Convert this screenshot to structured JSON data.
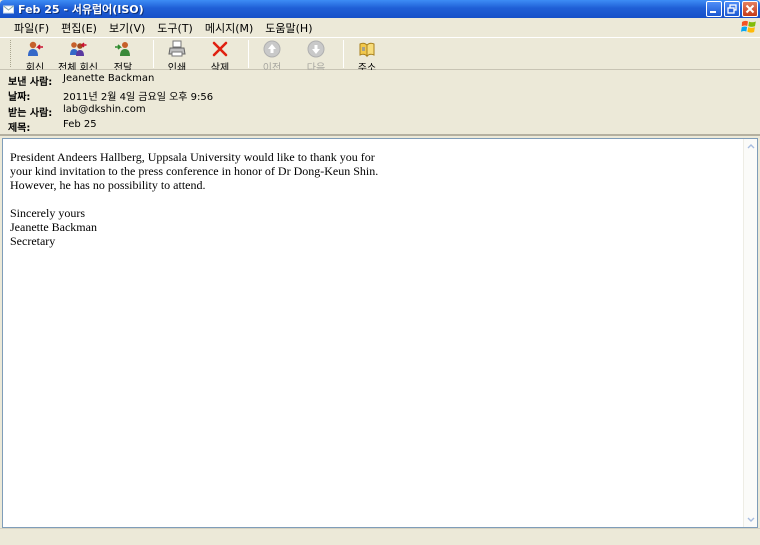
{
  "window": {
    "title": "Feb 25 - 서유럽어(ISO)"
  },
  "menu": [
    "파일(F)",
    "편집(E)",
    "보기(V)",
    "도구(T)",
    "메시지(M)",
    "도움말(H)"
  ],
  "toolbar": {
    "reply": "회신",
    "reply_all": "전체 회신",
    "forward": "전달",
    "print": "인쇄",
    "delete": "삭제",
    "previous": "이전",
    "next": "다음",
    "addresses": "주소"
  },
  "header": {
    "from_label": "보낸 사람:",
    "from_value": "Jeanette Backman",
    "date_label": "날짜:",
    "date_value": "2011년 2월 4일 금요일 오후 9:56",
    "to_label": "받는 사람:",
    "to_value": "lab@dkshin.com",
    "subject_label": "제목:",
    "subject_value": "Feb 25"
  },
  "message": {
    "paragraph1": "President Andeers Hallberg, Uppsala University would like to thank you for\nyour kind invitation to the press conference in honor of Dr Dong-Keun Shin.\nHowever, he has no possibility to attend.",
    "paragraph2": "Sincerely yours\nJeanette Backman\nSecretary"
  },
  "colors": {
    "titlebar": "#1f5fd6",
    "close_button": "#c43a1a",
    "delete_icon": "#e02010"
  }
}
